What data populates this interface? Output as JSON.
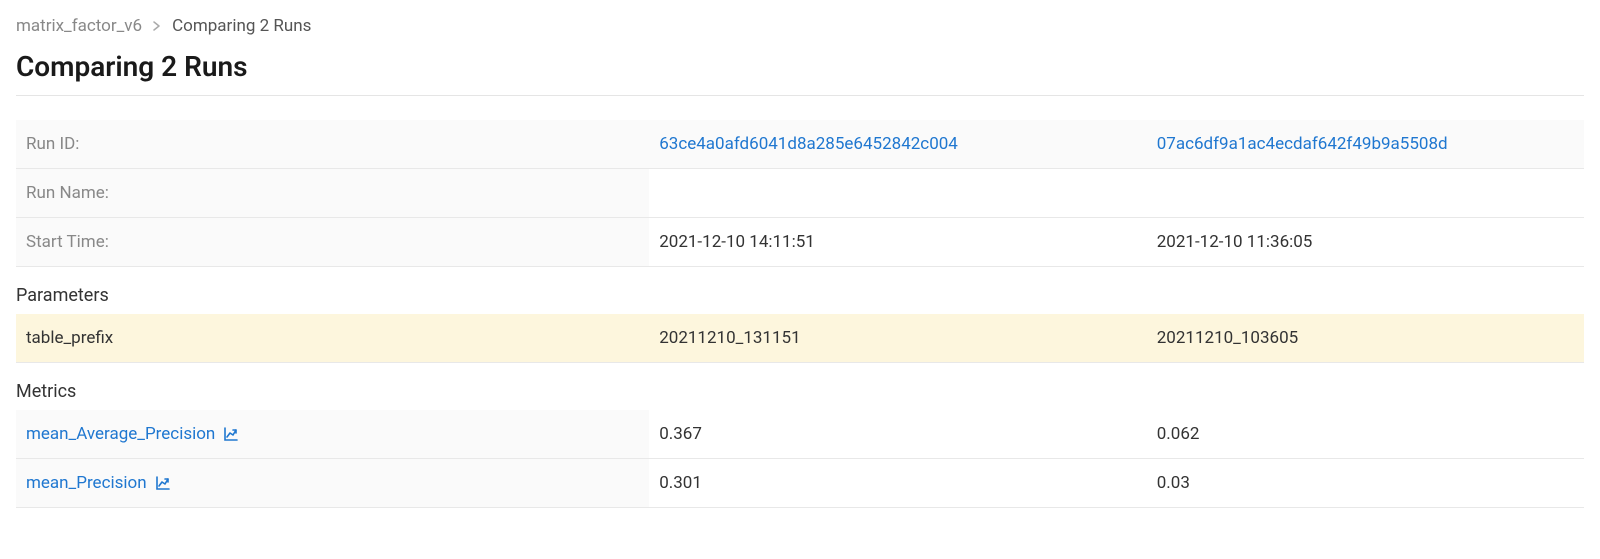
{
  "breadcrumb": {
    "parent": "matrix_factor_v6",
    "current": "Comparing 2 Runs"
  },
  "page_title": "Comparing 2 Runs",
  "info": {
    "rows": [
      {
        "label": "Run ID:",
        "values": [
          "63ce4a0afd6041d8a285e6452842c004",
          "07ac6df9a1ac4ecdaf642f49b9a5508d"
        ],
        "is_link": true
      },
      {
        "label": "Run Name:",
        "values": [
          "",
          ""
        ],
        "is_link": false
      },
      {
        "label": "Start Time:",
        "values": [
          "2021-12-10 14:11:51",
          "2021-12-10 11:36:05"
        ],
        "is_link": false
      }
    ]
  },
  "sections": {
    "parameters_title": "Parameters",
    "metrics_title": "Metrics"
  },
  "parameters": {
    "rows": [
      {
        "label": "table_prefix",
        "values": [
          "20211210_131151",
          "20211210_103605"
        ],
        "highlight": true
      }
    ]
  },
  "metrics": {
    "rows": [
      {
        "label": "mean_Average_Precision",
        "values": [
          "0.367",
          "0.062"
        ]
      },
      {
        "label": "mean_Precision",
        "values": [
          "0.301",
          "0.03"
        ]
      }
    ]
  }
}
